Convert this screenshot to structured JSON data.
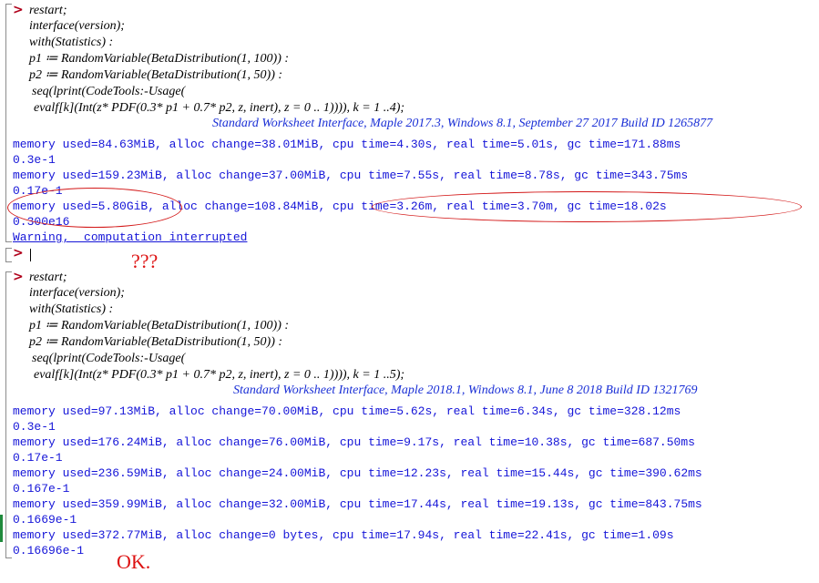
{
  "prompt_symbol": ">",
  "block1": {
    "input_lines": [
      "restart;",
      "interface(version);",
      "with(Statistics) :",
      "p1 ≔ RandomVariable(BetaDistribution(1, 100)) :",
      "p2 ≔ RandomVariable(BetaDistribution(1, 50)) :",
      "seq(lprint(CodeTools:-Usage(",
      "evalf[k](Int(z* PDF(0.3* p1 + 0.7* p2, z, inert), z = 0 .. 1)))), k = 1 ..4);"
    ],
    "version_banner": "Standard Worksheet Interface, Maple 2017.3, Windows 8.1, September 27 2017 Build ID 1265877",
    "output_lines": [
      "memory used=84.63MiB, alloc change=38.01MiB, cpu time=4.30s, real time=5.01s, gc time=171.88ms",
      "0.3e-1",
      "memory used=159.23MiB, alloc change=37.00MiB, cpu time=7.55s, real time=8.78s, gc time=343.75ms",
      "0.17e-1",
      "memory used=5.80GiB, alloc change=108.84MiB, cpu time=3.26m, real time=3.70m, gc time=18.02s",
      "0.300e16"
    ],
    "warning": "Warning,  computation interrupted"
  },
  "annotation_questions": "???",
  "block2": {
    "input_lines": [
      "restart;",
      "interface(version);",
      "with(Statistics) :",
      "p1 ≔ RandomVariable(BetaDistribution(1, 100)) :",
      "p2 ≔ RandomVariable(BetaDistribution(1, 50)) :",
      "seq(lprint(CodeTools:-Usage(",
      "evalf[k](Int(z* PDF(0.3* p1 + 0.7* p2, z, inert), z = 0 .. 1)))), k = 1 ..5);"
    ],
    "version_banner": "Standard Worksheet Interface, Maple 2018.1, Windows 8.1, June 8 2018 Build ID 1321769",
    "output_lines": [
      "memory used=97.13MiB, alloc change=70.00MiB, cpu time=5.62s, real time=6.34s, gc time=328.12ms",
      "0.3e-1",
      "memory used=176.24MiB, alloc change=76.00MiB, cpu time=9.17s, real time=10.38s, gc time=687.50ms",
      "0.17e-1",
      "memory used=236.59MiB, alloc change=24.00MiB, cpu time=12.23s, real time=15.44s, gc time=390.62ms",
      "0.167e-1",
      "memory used=359.99MiB, alloc change=32.00MiB, cpu time=17.44s, real time=19.13s, gc time=843.75ms",
      "0.1669e-1",
      "memory used=372.77MiB, alloc change=0 bytes, cpu time=17.94s, real time=22.41s, gc time=1.09s",
      "0.16696e-1"
    ]
  },
  "annotation_ok": "OK.",
  "colors": {
    "prompt": "#b0001a",
    "input_text": "#000000",
    "banner": "#1b30d6",
    "output": "#1515d8",
    "annotation": "#dd1111",
    "bracket": "#8c8c8c"
  }
}
